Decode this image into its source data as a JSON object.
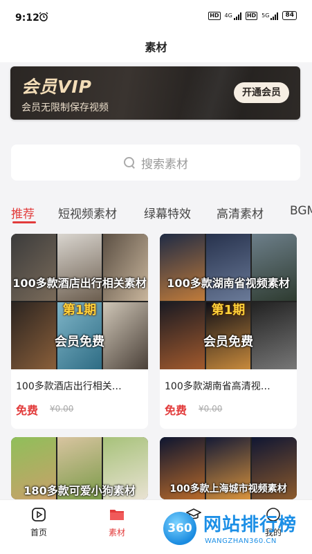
{
  "status_bar": {
    "time": "9:12",
    "battery": "84",
    "network1": "4G",
    "network2": "5G",
    "hd": "HD"
  },
  "header": {
    "title": "素材"
  },
  "vip_banner": {
    "title": "会员VIP",
    "subtitle": "会员无限制保存视频",
    "button": "开通会员"
  },
  "search": {
    "placeholder": "搜索素材"
  },
  "tabs": [
    "推荐",
    "短视频素材",
    "绿幕特效",
    "高清素材",
    "BGM"
  ],
  "cards": [
    {
      "thumb_title": "100多款酒店出行相关素材",
      "episode": "第1期",
      "badge": "会员免费",
      "title": "100多款酒店出行相关…",
      "price": "免费",
      "old_price": "¥0.00"
    },
    {
      "thumb_title": "100多款湖南省视频素材",
      "episode": "第1期",
      "badge": "会员免费",
      "title": "100多款湖南省高清视…",
      "price": "免费",
      "old_price": "¥0.00"
    },
    {
      "thumb_title": "180多款可爱小狗素材"
    },
    {
      "thumb_title": "100多款上海城市视频素材"
    }
  ],
  "bottom_nav": {
    "home": "首页",
    "material": "素材",
    "third": "",
    "mine": "我的"
  },
  "watermark": {
    "logo": "360",
    "cn": "网站排行榜",
    "en": "WANGZHAN360.CN"
  },
  "colors": {
    "accent": "#e23b3b",
    "vip_gold": "#f3ddb8"
  }
}
